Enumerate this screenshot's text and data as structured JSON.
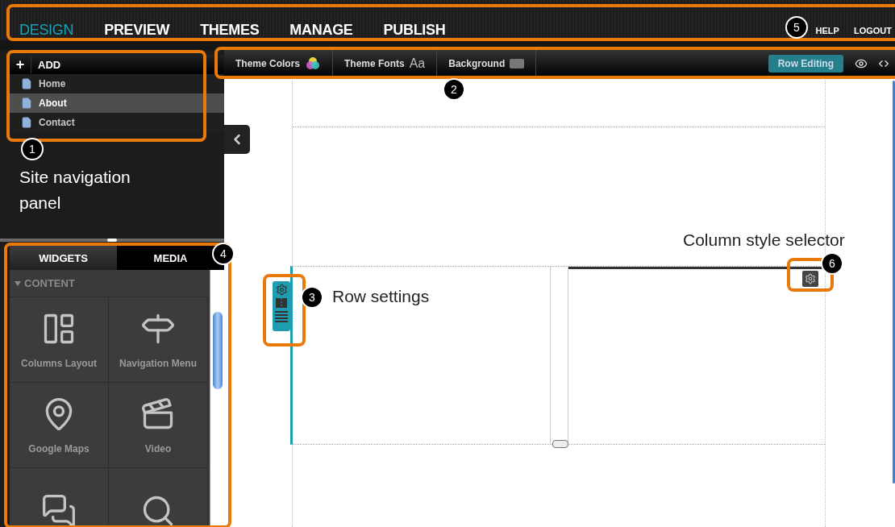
{
  "top_nav": {
    "tabs": [
      {
        "label": "DESIGN",
        "selected": true
      },
      {
        "label": "PREVIEW",
        "selected": false
      },
      {
        "label": "THEMES",
        "selected": false
      },
      {
        "label": "MANAGE",
        "selected": false
      },
      {
        "label": "PUBLISH",
        "selected": false
      }
    ],
    "links": [
      "HELP",
      "LOGOUT"
    ]
  },
  "pages_panel": {
    "add_label": "ADD",
    "add_symbol": "+",
    "pages": [
      {
        "label": "Home",
        "selected": false
      },
      {
        "label": "About",
        "selected": true
      },
      {
        "label": "Contact",
        "selected": false
      }
    ]
  },
  "toolbar": {
    "items": [
      {
        "label": "Theme Colors",
        "kind": "colors"
      },
      {
        "label": "Theme Fonts",
        "kind": "fonts",
        "glyph": "Aa"
      },
      {
        "label": "Background",
        "kind": "background"
      }
    ],
    "row_editing": {
      "label": "Row Editing",
      "on": true
    }
  },
  "widgets_panel": {
    "tabs": [
      {
        "label": "WIDGETS",
        "selected": true
      },
      {
        "label": "MEDIA",
        "selected": false
      }
    ],
    "section": {
      "label": "CONTENT",
      "expanded": true
    },
    "widgets": [
      {
        "label": "Columns Layout",
        "kind": "columns"
      },
      {
        "label": "Navigation Menu",
        "kind": "signpost"
      },
      {
        "label": "Google Maps",
        "kind": "pin"
      },
      {
        "label": "Video",
        "kind": "clapper"
      },
      {
        "kind": "chat"
      },
      {
        "kind": "search"
      }
    ]
  },
  "callouts": [
    {
      "number": "1",
      "label": "Site navigation panel"
    },
    {
      "number": "2"
    },
    {
      "number": "3",
      "label": "Row settings"
    },
    {
      "number": "4"
    },
    {
      "number": "5"
    },
    {
      "number": "6",
      "label": "Column style selector"
    }
  ]
}
